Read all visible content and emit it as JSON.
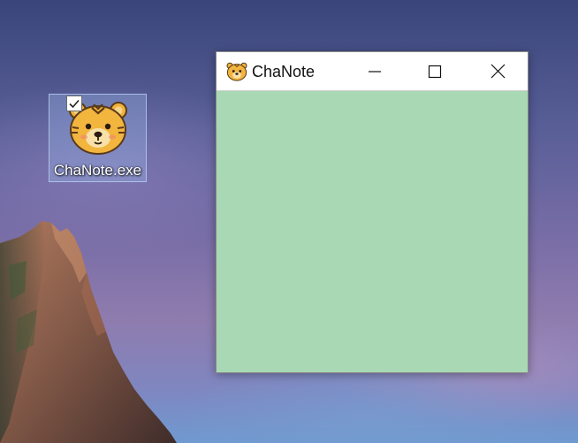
{
  "desktop": {
    "icon": {
      "label": "ChaNote.exe",
      "icon_name": "tiger-app-icon",
      "selected": true
    }
  },
  "window": {
    "title": "ChaNote",
    "app_icon_name": "tiger-app-icon",
    "controls": {
      "minimize_icon": "minimize-icon",
      "maximize_icon": "maximize-icon",
      "close_icon": "close-icon"
    },
    "client_color": "#a8d8b4"
  }
}
